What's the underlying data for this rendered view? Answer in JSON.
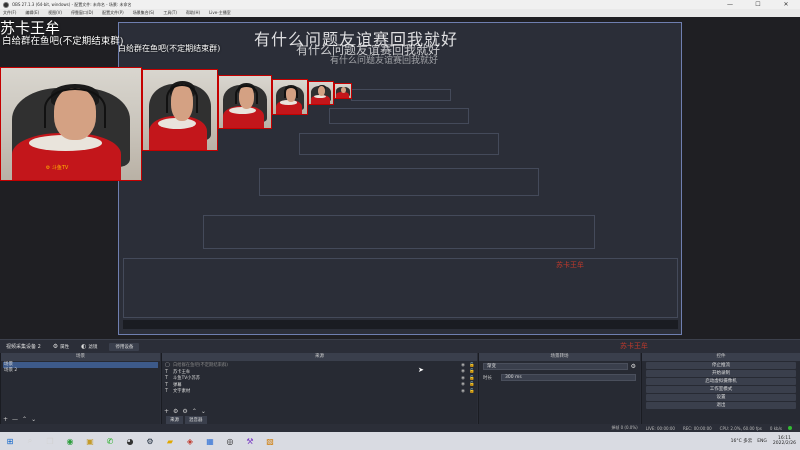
{
  "window": {
    "title": "OBS 27.1.3 (64-bit, windows) - 配置文件: 未命名 - 场景: 未命名",
    "minimize": "—",
    "maximize": "☐",
    "close": "✕"
  },
  "menu": [
    "文件(F)",
    "编辑(E)",
    "视图(V)",
    "停靠窗口(D)",
    "配置文件(P)",
    "场景集合(S)",
    "工具(T)",
    "帮助(H)",
    "Live-主播室"
  ],
  "overlay": {
    "title": "苏卡王牟",
    "subtitle": "白给群在鱼吧(不定期结束群)",
    "subtitle_repeat": "白给群在鱼吧(不定期结束群)",
    "banner": "有什么问题友谊赛回我就好",
    "banner_repeat_1": "有什么问题友谊赛回我就好",
    "banner_repeat_2": "有什么问题友谊赛回我就好",
    "webcam_watermark": "⚙ 斗鱼TV",
    "stamp": "苏卡王牟"
  },
  "toolbar": {
    "scene_label": "视频采集设备 2",
    "properties": "属性",
    "filters": "滤镜",
    "deactivate": "停用设备"
  },
  "scenes": {
    "header": "场景",
    "items": [
      "场景",
      "场景 2"
    ],
    "footer": [
      "+",
      "—",
      "⌃",
      "⌄"
    ]
  },
  "sources": {
    "header": "来源",
    "items": [
      {
        "icon": "▢",
        "name": "白给群在鱼吧(不定期结束群)",
        "dim": true
      },
      {
        "icon": "T",
        "name": "苏卡王牟"
      },
      {
        "icon": "T",
        "name": "斗鱼TV小苏苏"
      },
      {
        "icon": "T",
        "name": "弹幕"
      },
      {
        "icon": "T",
        "name": "文字素材"
      }
    ],
    "eye": "◉",
    "lock": "🔓",
    "footer": [
      "+",
      "⚙",
      "⚙",
      "⌃",
      "⌄"
    ],
    "tabs": [
      "来源",
      "混音器"
    ]
  },
  "mixer": {
    "header": "场景转场",
    "transition_value": "渐变",
    "duration_label": "时长",
    "duration_value": "300 ms",
    "gear": "⚙"
  },
  "controls": {
    "header": "控件",
    "buttons": [
      "停止推流",
      "开始录制",
      "启动虚拟摄像机",
      "工作室模式",
      "设置",
      "退出"
    ]
  },
  "status": {
    "dropped": "掉帧 0 (0.0%)",
    "live": "LIVE: 00:00:00",
    "rec": "REC: 00:00:00",
    "cpu": "CPU: 2.0%, 60.00 fps",
    "kbps": "0 kb/s"
  },
  "taskbar": {
    "icons": [
      {
        "name": "windows-start-icon",
        "glyph": "⊞"
      },
      {
        "name": "search-icon",
        "glyph": "⌕"
      },
      {
        "name": "task-view-icon",
        "glyph": "❐"
      },
      {
        "name": "chrome-icon",
        "glyph": "◉"
      },
      {
        "name": "game-icon",
        "glyph": "▣"
      },
      {
        "name": "wechat-icon",
        "glyph": "✆"
      },
      {
        "name": "qq-icon",
        "glyph": "◕"
      },
      {
        "name": "steam-icon",
        "glyph": "⚙"
      },
      {
        "name": "folder-icon",
        "glyph": "▰"
      },
      {
        "name": "app-icon",
        "glyph": "◈"
      },
      {
        "name": "store-icon",
        "glyph": "▦"
      },
      {
        "name": "obs-icon",
        "glyph": "◎"
      },
      {
        "name": "settings-icon",
        "glyph": "⚒"
      },
      {
        "name": "game2-icon",
        "glyph": "▧"
      }
    ],
    "weather": "16°C 多云",
    "lang": "ENG",
    "time": "16:11",
    "date": "2022/2/26"
  },
  "colors": {
    "accent_red": "#c40000",
    "selected_blue": "#3d5a8a",
    "panel_bg": "#272a33"
  }
}
